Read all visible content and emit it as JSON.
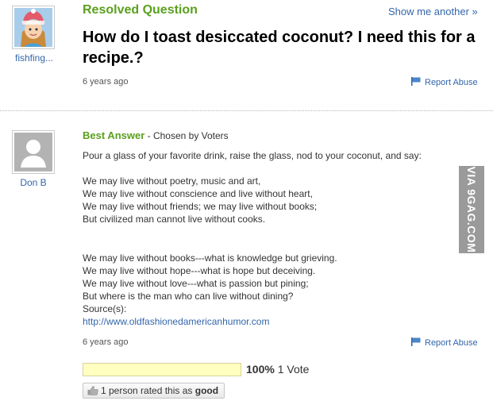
{
  "question": {
    "status_label": "Resolved Question",
    "show_another": "Show me another »",
    "title": "How do I toast desiccated coconut? I need this for a recipe.?",
    "asker": "fishfing...",
    "time": "6 years ago",
    "report_abuse": "Report Abuse"
  },
  "answer": {
    "best_label": "Best Answer",
    "chosen_by": " - Chosen by Voters",
    "answerer": "Don B",
    "intro": "Pour a glass of your favorite drink, raise the glass, nod to your coconut, and say:",
    "stanza1": [
      "We may live without poetry, music and art,",
      "We may live without conscience and live without heart,",
      "We may live without friends; we may live without books;",
      "But civilized man cannot live without cooks."
    ],
    "stanza2": [
      "We may live without books---what is knowledge but grieving.",
      "We may live without hope---what is hope but deceiving.",
      "We may live without love---what is passion but pining;",
      "But where is the man who can live without dining?"
    ],
    "sources_label": "Source(s):",
    "source_url": "http://www.oldfashionedamericanhumor.com",
    "time": "6 years ago",
    "report_abuse": "Report Abuse"
  },
  "votes": {
    "percent": "100%",
    "count_label": "1 Vote",
    "fill_fraction": 1.0
  },
  "rating": {
    "text": "1 person rated this as ",
    "value": "good"
  },
  "watermark": "VIA 9GAG.COM",
  "colors": {
    "accent_green": "#5aa01e",
    "link_blue": "#3366aa",
    "vote_fill": "#ffffc0"
  }
}
